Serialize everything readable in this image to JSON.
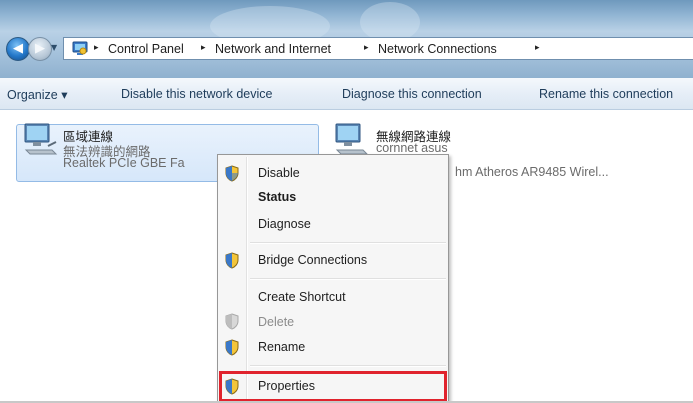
{
  "breadcrumb": {
    "items": [
      "Control Panel",
      "Network and Internet",
      "Network Connections"
    ],
    "separator": "▸"
  },
  "nav": {
    "back_icon": "back-arrow-icon",
    "forward_icon": "forward-arrow-icon"
  },
  "commandbar": {
    "organize": "Organize ▾",
    "disable": "Disable this network device",
    "diagnose": "Diagnose this connection",
    "rename": "Rename this connection"
  },
  "connections": [
    {
      "name": "區域連線",
      "status": "無法辨識的網路",
      "device": "Realtek PCIe GBE Fa",
      "selected": true
    },
    {
      "name": "無線網路連線",
      "status": "cornnet asus",
      "device": "hm Atheros AR9485 Wirel..."
    }
  ],
  "context_menu": {
    "items": [
      {
        "label": "Disable",
        "icon": "uac-shield-icon"
      },
      {
        "label": "Status",
        "bold": true
      },
      {
        "label": "Diagnose"
      },
      {
        "label": "Bridge Connections",
        "icon": "uac-shield-icon"
      },
      {
        "label": "Create Shortcut"
      },
      {
        "label": "Delete",
        "icon": "uac-shield-icon-disabled",
        "disabled": true
      },
      {
        "label": "Rename",
        "icon": "uac-shield-icon"
      },
      {
        "label": "Properties",
        "icon": "uac-shield-icon",
        "highlighted": true
      }
    ]
  },
  "colors": {
    "highlight_box": "#e0232d",
    "selection_fill": "#d6e7fa"
  }
}
